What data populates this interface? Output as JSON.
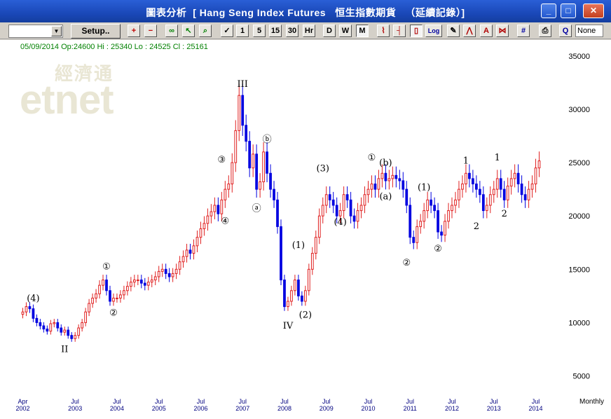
{
  "window": {
    "title": "圖表分析  [ Hang Seng Index Futures   恒生指數期貨   （延續記錄）]",
    "min_label": "_",
    "max_label": "□",
    "close_label": "✕"
  },
  "toolbar": {
    "setup_label": "Setup..",
    "none_label": "None",
    "buttons": [
      {
        "name": "zoom-in-icon",
        "label": "+"
      },
      {
        "name": "zoom-out-icon",
        "label": "−"
      },
      {
        "name": "binoculars-icon",
        "label": "∞"
      },
      {
        "name": "arrow-cursor-icon",
        "label": "↖"
      },
      {
        "name": "magnifier-icon",
        "label": "⌕"
      },
      {
        "name": "check-icon",
        "label": "✓"
      },
      {
        "name": "interval-1",
        "label": "1"
      },
      {
        "name": "interval-5",
        "label": "5"
      },
      {
        "name": "interval-15",
        "label": "15"
      },
      {
        "name": "interval-30",
        "label": "30"
      },
      {
        "name": "interval-hr",
        "label": "Hr"
      },
      {
        "name": "interval-d",
        "label": "D"
      },
      {
        "name": "interval-w",
        "label": "W"
      },
      {
        "name": "interval-m",
        "label": "M"
      },
      {
        "name": "line-chart-icon",
        "label": "⌇"
      },
      {
        "name": "bar-chart-icon",
        "label": "┤"
      },
      {
        "name": "candle-chart-icon",
        "label": "▯"
      },
      {
        "name": "log-scale",
        "label": "Log"
      },
      {
        "name": "pencil-icon",
        "label": "✎"
      },
      {
        "name": "indicator-icon",
        "label": "⋀"
      },
      {
        "name": "ah-icon",
        "label": "A"
      },
      {
        "name": "compare-icon",
        "label": "⋈"
      },
      {
        "name": "grid-icon",
        "label": "#"
      },
      {
        "name": "print-icon",
        "label": "⎙"
      },
      {
        "name": "query-icon",
        "label": "Q"
      }
    ]
  },
  "info_line": "05/09/2014 Op:24600 Hi : 25340 Lo : 24525 Cl : 25161",
  "logo": {
    "cn": "經濟通",
    "en": "etnet"
  },
  "chart_data": {
    "type": "candlestick",
    "frequency_label": "Monthly",
    "y_ticks": [
      5000,
      10000,
      15000,
      20000,
      25000,
      30000,
      35000
    ],
    "y_range": [
      3000,
      36500
    ],
    "x_labels": [
      {
        "top": "Apr",
        "bottom": "2002",
        "index": 0
      },
      {
        "top": "Jul",
        "bottom": "2003",
        "index": 15
      },
      {
        "top": "Jul",
        "bottom": "2004",
        "index": 27
      },
      {
        "top": "Jul",
        "bottom": "2005",
        "index": 39
      },
      {
        "top": "Jul",
        "bottom": "2006",
        "index": 51
      },
      {
        "top": "Jul",
        "bottom": "2007",
        "index": 63
      },
      {
        "top": "Jul",
        "bottom": "2008",
        "index": 75
      },
      {
        "top": "Jul",
        "bottom": "2009",
        "index": 87
      },
      {
        "top": "Jul",
        "bottom": "2010",
        "index": 99
      },
      {
        "top": "Jul",
        "bottom": "2011",
        "index": 111
      },
      {
        "top": "Jul",
        "bottom": "2012",
        "index": 123
      },
      {
        "top": "Jul",
        "bottom": "2013",
        "index": 135
      },
      {
        "top": "Jul",
        "bottom": "2014",
        "index": 147
      }
    ],
    "closes": [
      11000,
      11500,
      11300,
      10400,
      10000,
      9700,
      9400,
      9200,
      9900,
      10000,
      9500,
      9100,
      9300,
      8800,
      8500,
      8800,
      9500,
      10000,
      11000,
      11800,
      12300,
      12700,
      13500,
      14000,
      13000,
      12000,
      12300,
      12300,
      12600,
      13000,
      13400,
      13800,
      14000,
      14000,
      13700,
      13500,
      13800,
      14000,
      14300,
      14800,
      15000,
      14600,
      14300,
      14600,
      15000,
      15700,
      16200,
      16800,
      16500,
      17200,
      18000,
      18800,
      19300,
      20000,
      20400,
      21000,
      20200,
      21500,
      22500,
      23000,
      25000,
      28000,
      31300,
      28500,
      27000,
      24500,
      25800,
      22500,
      23200,
      26000,
      24000,
      22500,
      21500,
      19000,
      14000,
      11500,
      12000,
      13000,
      14000,
      12500,
      12000,
      13000,
      15000,
      16500,
      18000,
      20000,
      21000,
      22000,
      21500,
      21000,
      20000,
      20500,
      22000,
      21500,
      20000,
      19500,
      20500,
      21000,
      22000,
      22500,
      23000,
      22500,
      23500,
      24000,
      23300,
      23500,
      23800,
      23500,
      23300,
      22500,
      21000,
      18000,
      17500,
      19000,
      19500,
      20500,
      21500,
      21000,
      20500,
      18500,
      18200,
      19500,
      20500,
      21000,
      21500,
      22500,
      23000,
      24000,
      23500,
      23000,
      22500,
      22000,
      20500,
      21000,
      22000,
      22500,
      23500,
      22500,
      21500,
      22800,
      23500,
      24000,
      23000,
      22000,
      21500,
      22500,
      23000,
      24500,
      25161
    ],
    "wave_labels": [
      {
        "text": "(4)",
        "index": 3,
        "value": 11600,
        "pos": "above"
      },
      {
        "text": "II",
        "index": 12,
        "value": 8300,
        "pos": "below"
      },
      {
        "text": "①",
        "index": 24,
        "value": 14600,
        "pos": "above"
      },
      {
        "text": "②",
        "index": 26,
        "value": 11700,
        "pos": "below"
      },
      {
        "text": "III",
        "index": 63,
        "value": 31700,
        "pos": "above"
      },
      {
        "text": "③",
        "index": 57,
        "value": 24600,
        "pos": "above"
      },
      {
        "text": "④",
        "index": 58,
        "value": 20300,
        "pos": "below"
      },
      {
        "text": "ⓑ",
        "index": 70,
        "value": 26500,
        "pos": "above"
      },
      {
        "text": "ⓐ",
        "index": 67,
        "value": 21500,
        "pos": "below"
      },
      {
        "text": "IV",
        "index": 76,
        "value": 10500,
        "pos": "below"
      },
      {
        "text": "(1)",
        "index": 79,
        "value": 16600,
        "pos": "above"
      },
      {
        "text": "(2)",
        "index": 81,
        "value": 11500,
        "pos": "below"
      },
      {
        "text": "(3)",
        "index": 86,
        "value": 23800,
        "pos": "above"
      },
      {
        "text": "(4)",
        "index": 91,
        "value": 20200,
        "pos": "below"
      },
      {
        "text": "①",
        "index": 100,
        "value": 24800,
        "pos": "above"
      },
      {
        "text": "(b)",
        "index": 104,
        "value": 24300,
        "pos": "above"
      },
      {
        "text": "(a)",
        "index": 104,
        "value": 22600,
        "pos": "below"
      },
      {
        "text": "②",
        "index": 110,
        "value": 16400,
        "pos": "below"
      },
      {
        "text": "(1)",
        "index": 115,
        "value": 22000,
        "pos": "above"
      },
      {
        "text": "②",
        "index": 119,
        "value": 17700,
        "pos": "below"
      },
      {
        "text": "1",
        "index": 127,
        "value": 24500,
        "pos": "above"
      },
      {
        "text": "2",
        "index": 130,
        "value": 19800,
        "pos": "below"
      },
      {
        "text": "1",
        "index": 136,
        "value": 24800,
        "pos": "above"
      },
      {
        "text": "2",
        "index": 138,
        "value": 21000,
        "pos": "below"
      }
    ]
  }
}
